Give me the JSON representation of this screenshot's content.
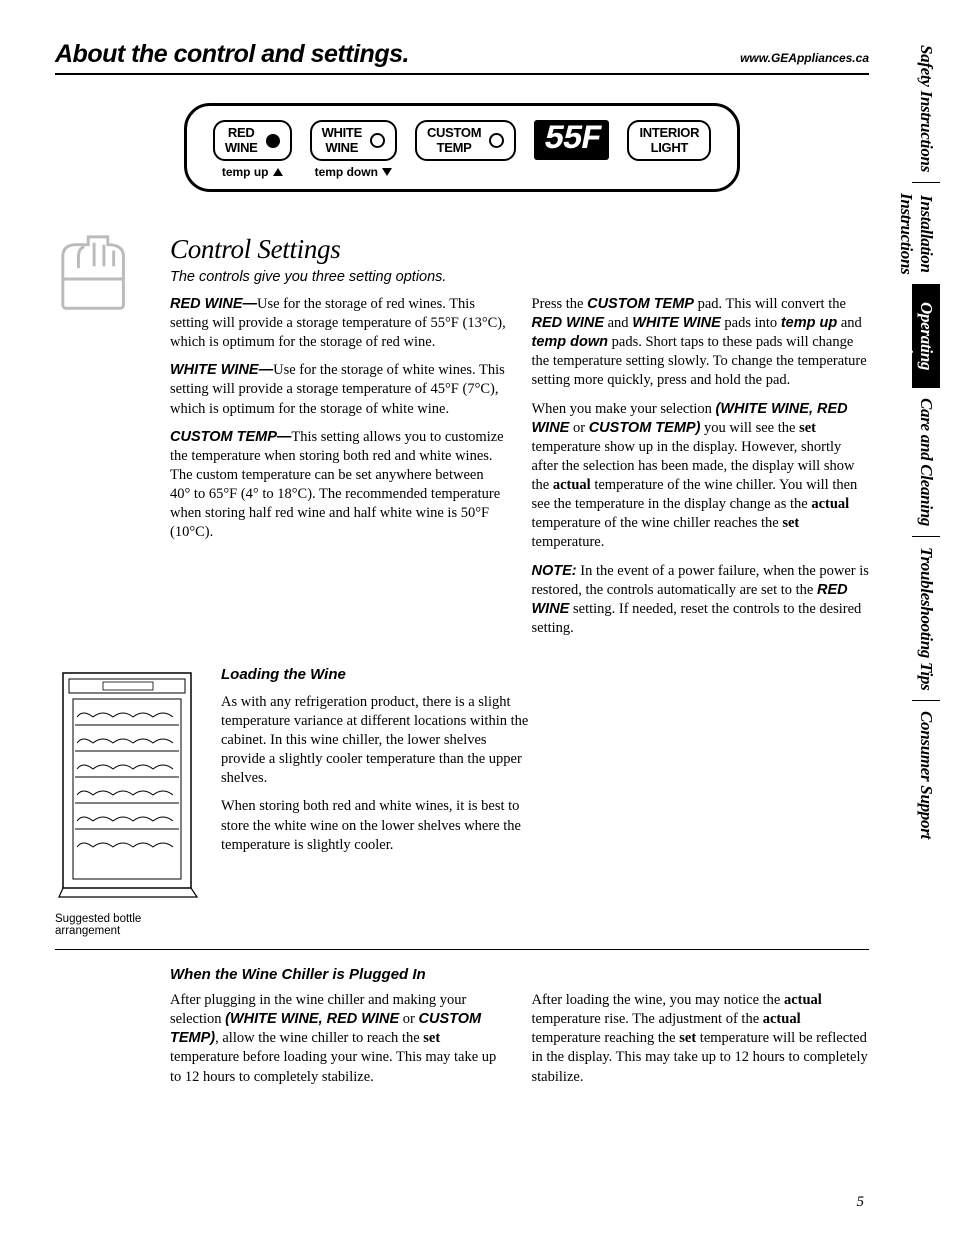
{
  "header": {
    "title": "About the control and settings.",
    "url": "www.GEAppliances.ca"
  },
  "side_tabs": [
    {
      "label": "Safety Instructions",
      "active": false
    },
    {
      "label": "Installation\nInstructions",
      "active": false
    },
    {
      "label": "Operating\nInstructions",
      "active": true
    },
    {
      "label": "Care and Cleaning",
      "active": false
    },
    {
      "label": "Troubleshooting Tips",
      "active": false
    },
    {
      "label": "Consumer Support",
      "active": false
    }
  ],
  "panel": {
    "red": {
      "line1": "RED",
      "line2": "WINE",
      "below": "temp up"
    },
    "white": {
      "line1": "WHITE",
      "line2": "WINE",
      "below": "temp down"
    },
    "custom": {
      "line1": "CUSTOM",
      "line2": "TEMP"
    },
    "display": "55F",
    "light": {
      "line1": "INTERIOR",
      "line2": "LIGHT"
    }
  },
  "control_settings": {
    "title": "Control Settings",
    "subtitle": "The controls give you three setting options.",
    "left": {
      "p1a": "RED WINE—",
      "p1b": "Use for the storage of red wines. This setting will provide a storage temperature of 55°F (13°C), which is optimum for the storage of red wine.",
      "p2a": "WHITE WINE—",
      "p2b": "Use for the storage of white wines. This setting will provide a storage temperature of 45°F (7°C), which is optimum for the storage of white wine.",
      "p3a": "CUSTOM TEMP—",
      "p3b": "This setting allows you to customize the temperature when storing both red and white wines. The custom temperature can be set anywhere between 40° to 65°F (4° to 18°C). The recommended temperature when storing half red wine and half white wine is 50°F (10°C)."
    },
    "right": {
      "p1a": "Press the ",
      "p1b": "CUSTOM TEMP",
      "p1c": " pad. This will convert the ",
      "p1d": "RED WINE",
      "p1e": " and ",
      "p1f": "WHITE WINE",
      "p1g": " pads into ",
      "p1h": "temp up",
      "p1i": " and ",
      "p1j": "temp down",
      "p1k": " pads. Short taps to these pads will change the temperature setting slowly. To change the temperature setting more quickly, press and hold the pad.",
      "p2a": "When you make your selection ",
      "p2b": "(WHITE WINE, RED WINE",
      "p2c": " or ",
      "p2d": "CUSTOM TEMP)",
      "p2e": " you will see the ",
      "p2f": "set",
      "p2g": " temperature show up in the display. However, shortly after the selection has been made, the display will show the ",
      "p2h": "actual",
      "p2i": " temperature of the wine chiller. You will then see the temperature in the display change as the ",
      "p2j": "actual",
      "p2k": " temperature of the wine chiller reaches the ",
      "p2l": "set",
      "p2m": " temperature.",
      "p3a": "NOTE:",
      "p3b": " In the event of a power failure, when the power is restored, the controls automatically are set to the ",
      "p3c": "RED WINE",
      "p3d": " setting. If needed, reset the controls to the desired setting."
    }
  },
  "loading": {
    "heading": "Loading the Wine",
    "p1": "As with any refrigeration product, there is a slight temperature variance at different locations within the cabinet. In this wine chiller, the lower shelves provide a slightly cooler temperature than the upper shelves.",
    "p2": "When storing both red and white wines, it is best to store the white wine on the lower shelves where the temperature is slightly cooler.",
    "caption": "Suggested bottle arrangement"
  },
  "plugged": {
    "heading": "When the Wine Chiller is Plugged In",
    "left": {
      "a": "After plugging in the wine chiller and making your selection ",
      "b": "(WHITE WINE, RED WINE",
      "c": " or ",
      "d": "CUSTOM TEMP)",
      "e": ", allow the wine chiller to reach the ",
      "f": "set",
      "g": " temperature before loading your wine. This may take up to 12 hours to completely stabilize."
    },
    "right": {
      "a": "After loading the wine, you may notice the ",
      "b": "actual",
      "c": " temperature rise. The adjustment of the ",
      "d": "actual",
      "e": " temperature reaching the ",
      "f": "set",
      "g": " temperature will be reflected in the display. This may take up to 12 hours to completely stabilize."
    }
  },
  "page_number": "5"
}
